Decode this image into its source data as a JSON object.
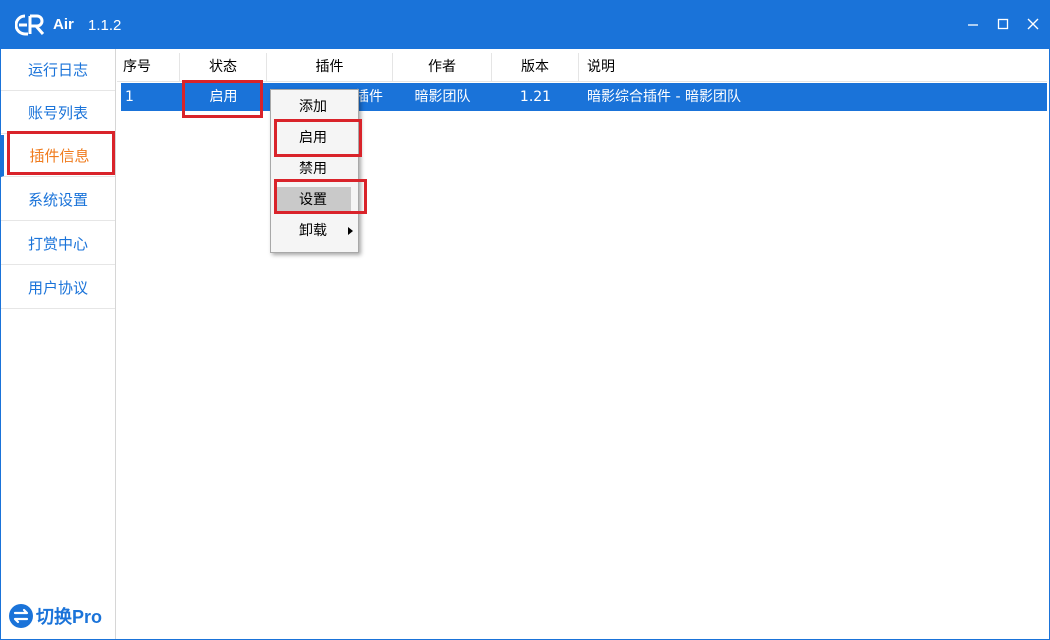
{
  "app": {
    "name": "Air",
    "version": "1.1.2",
    "brand_color": "#1a73d9",
    "active_color": "#f07c1e",
    "highlight_color": "#d9232a"
  },
  "window_controls": {
    "minimize": "–",
    "maximize": "☐",
    "close": "✕"
  },
  "sidebar": {
    "items": [
      {
        "label": "运行日志",
        "active": false
      },
      {
        "label": "账号列表",
        "active": false
      },
      {
        "label": "插件信息",
        "active": true
      },
      {
        "label": "系统设置",
        "active": false
      },
      {
        "label": "打赏中心",
        "active": false
      },
      {
        "label": "用户协议",
        "active": false
      }
    ],
    "footer_label": "切换Pro"
  },
  "table": {
    "columns": [
      "序号",
      "状态",
      "插件",
      "作者",
      "版本",
      "说明"
    ],
    "rows": [
      {
        "index": "1",
        "status": "启用",
        "plugin": "暗影综合插件",
        "plugin_visible": "插件",
        "author": "暗影团队",
        "version": "1.21",
        "description": "暗影综合插件 - 暗影团队"
      }
    ]
  },
  "context_menu": {
    "items": [
      {
        "label": "添加"
      },
      {
        "label": "启用"
      },
      {
        "label": "禁用"
      },
      {
        "label": "设置",
        "hover": true
      },
      {
        "label": "卸载",
        "has_submenu": true
      }
    ]
  }
}
